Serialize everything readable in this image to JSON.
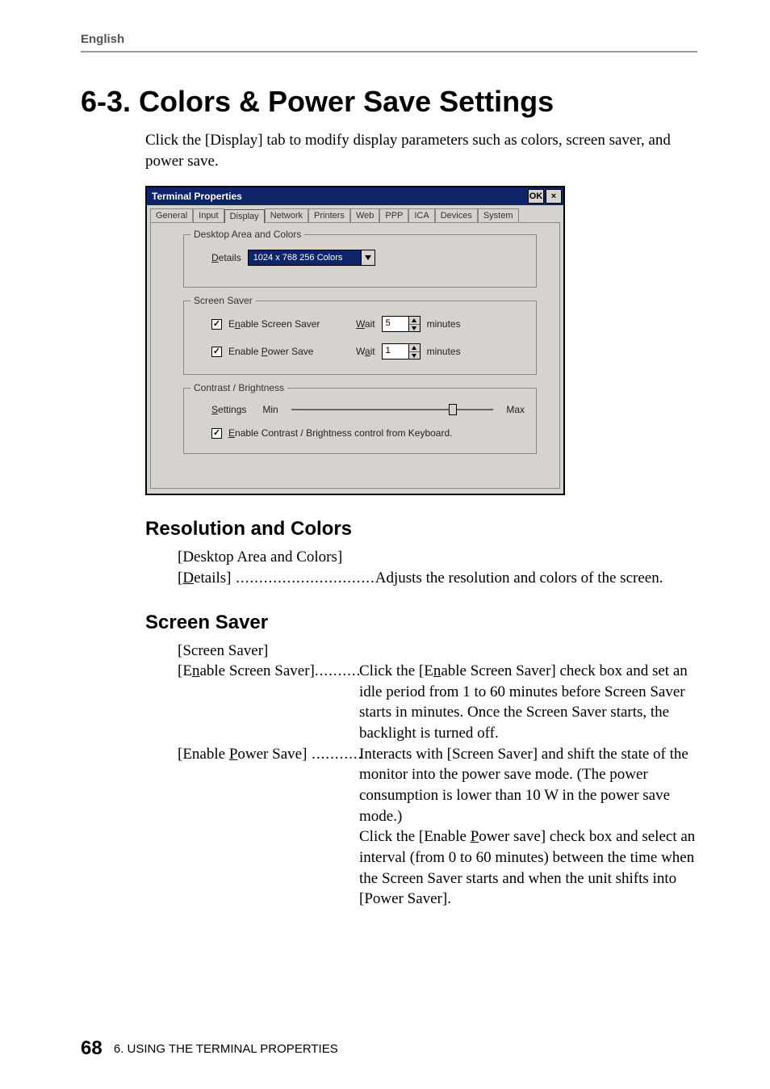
{
  "header": {
    "language": "English"
  },
  "title": "6-3. Colors & Power Save Settings",
  "intro": "Click the [Display] tab to modify display parameters such as colors, screen saver, and power save.",
  "dialog": {
    "title": "Terminal Properties",
    "ok": "OK",
    "close": "×",
    "tabs": [
      "General",
      "Input",
      "Display",
      "Network",
      "Printers",
      "Web",
      "PPP",
      "ICA",
      "Devices",
      "System"
    ],
    "active_tab": "Display",
    "groups": {
      "colors": {
        "legend": "Desktop Area and Colors",
        "details_label_pre": "D",
        "details_label_post": "etails",
        "combo_value": "1024 x 768 256 Colors"
      },
      "saver": {
        "legend": "Screen Saver",
        "enable_ss_pre": "E",
        "enable_ss_mid": "n",
        "enable_ss_post": "able Screen Saver",
        "enable_ps_pre": "Enable ",
        "enable_ps_mid": "P",
        "enable_ps_post": "ower Save",
        "wait1_pre": "W",
        "wait1_post": "ait",
        "wait2_pre": "W",
        "wait2_mid": "a",
        "wait2_post": "it",
        "val1": "5",
        "val2": "1",
        "minutes": "minutes"
      },
      "contrast": {
        "legend": "Contrast / Brightness",
        "settings_pre": "S",
        "settings_post": "ettings",
        "min": "Min",
        "max": "Max",
        "enable_pre": "E",
        "enable_post": "nable Contrast / Brightness control from Keyboard."
      }
    }
  },
  "sections": {
    "resolution": {
      "heading": "Resolution and Colors",
      "l1": "[Desktop Area and Colors]",
      "l2_term_open": "[",
      "l2_term_u": "D",
      "l2_term_rest": "etails]",
      "l2_dots": " ..............................",
      "l2_desc": "Adjusts the resolution and colors of the screen."
    },
    "saver": {
      "heading": "Screen Saver",
      "l1": "[Screen Saver]",
      "ss_term_open": "[E",
      "ss_term_u": "n",
      "ss_term_rest": "able Screen Saver]",
      "ss_dots": "..........",
      "ss_desc1_a": "Click the [E",
      "ss_desc1_u": "n",
      "ss_desc1_b": "able Screen Saver] check box and set an idle period from 1 to 60 minutes before Screen Saver starts in minutes.  Once the Screen Saver starts, the backlight is turned off.",
      "ps_term_open": "[Enable ",
      "ps_term_u": "P",
      "ps_term_rest": "ower Save]",
      "ps_dots": " ...........",
      "ps_desc1": "Interacts with [Screen Saver] and shift the state of the monitor into the power save mode.  (The power consumption is lower than 10 W in the power save mode.)",
      "ps_desc2_a": "Click the [Enable ",
      "ps_desc2_u": "P",
      "ps_desc2_b": "ower save] check box and select an interval (from 0 to 60 minutes) between the time when the Screen Saver starts and when the unit shifts into [Power Saver]."
    }
  },
  "footer": {
    "page": "68",
    "chapter": "6. USING THE TERMINAL PROPERTIES"
  }
}
